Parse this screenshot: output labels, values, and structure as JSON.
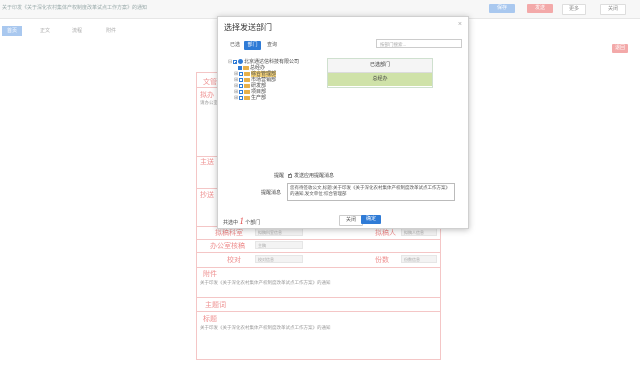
{
  "topbar": {
    "doc_title": "关于印发《关于深化农村集体产权制度改革试点工作方案》的通知",
    "btn_blue_1": "保存",
    "btn_blue_2": "发送",
    "btn_red": "退回",
    "menu": "更多",
    "close": "关闭"
  },
  "tabs": [
    "首页",
    "正文",
    "流程",
    "附件"
  ],
  "side_tag": "退回",
  "form": {
    "wenguan_label": "文管",
    "niban_label": "拟办",
    "niban_val": "请办公室...",
    "zhusong_label": "主送",
    "chaosong_label": "抄送",
    "rows": [
      {
        "label": "拟稿科室",
        "input": "拟稿科室信息",
        "label2": "拟稿人",
        "input2": "拟稿人信息"
      },
      {
        "label": "办公室核稿",
        "input": "主稿"
      },
      {
        "label": "校对",
        "input": "校对信息",
        "label2": "份数",
        "input2": "份数信息"
      }
    ],
    "fujian_label": "附件",
    "fujian_val": "关于印发《关于深化农村集体产权制度改革试点工作方案》的通知",
    "zhuti_label": "主题词",
    "biaoti_label": "标题",
    "biaoti_val": "关于印发《关于深化农村集体产权制度改革试点工作方案》的通知"
  },
  "dialog": {
    "title": "选择发送部门",
    "close": "×",
    "tabs": [
      "已选",
      "部门",
      "查询"
    ],
    "search_placeholder": "按部门搜索...",
    "tree": {
      "root": "北京通达信科技有限公司",
      "children": [
        "总经办",
        "综合管理部",
        "市场营销部",
        "研发部",
        "项目部",
        "生产部"
      ]
    },
    "selected_header": "已选部门",
    "selected_items": [
      "总经办"
    ],
    "remind_label": "提醒",
    "remind_option": "发送应用提醒消息",
    "msg_label": "提醒消息",
    "msg_text": "您有待签收公文,标题:关于印发《关于深化农村集体产权制度改革试点工作方案》的通知,发文单位:综合管理部",
    "count_prefix": "共选中",
    "count_value": "1",
    "count_suffix": "个部门",
    "cancel": "关闭",
    "ok": "确定"
  },
  "colors": {
    "accent": "#2f7bd6",
    "form_red": "#ee8f8f",
    "selected_green": "#cfe2a8"
  }
}
